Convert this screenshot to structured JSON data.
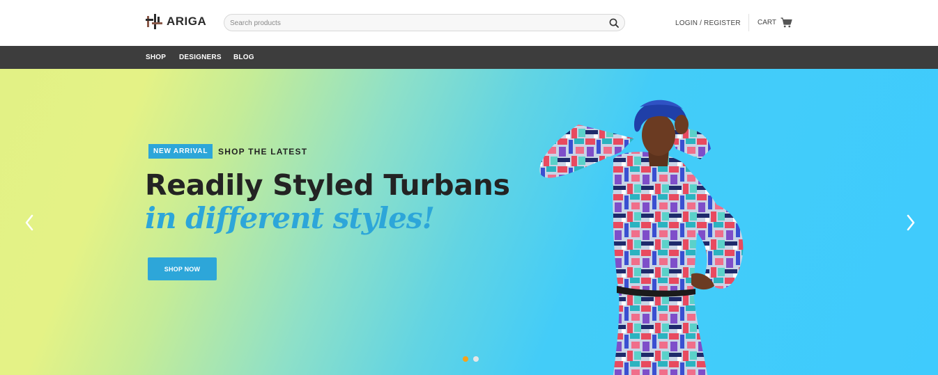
{
  "brand": {
    "name": "ARIGA"
  },
  "search": {
    "placeholder": "Search products"
  },
  "account": {
    "login_label": "LOGIN / REGISTER",
    "cart_label": "CART"
  },
  "nav": {
    "items": [
      {
        "label": "SHOP"
      },
      {
        "label": "DESIGNERS"
      },
      {
        "label": "BLOG"
      }
    ]
  },
  "hero": {
    "badge": "NEW ARRIVAL",
    "badge_side": "SHOP THE LATEST",
    "headline": "Readily Styled Turbans",
    "subhead": "in different styles!",
    "cta_label": "SHOP NOW",
    "slides_total": 2,
    "active_slide": 1
  },
  "colors": {
    "accent": "#2da6d9",
    "nav_bg": "#3d3d3d",
    "dot_active": "#f4a21d",
    "dot_inactive": "#e6e6e6"
  },
  "icons": [
    "ariga-logo-icon",
    "search-icon",
    "cart-icon",
    "chevron-left-icon",
    "chevron-right-icon"
  ]
}
